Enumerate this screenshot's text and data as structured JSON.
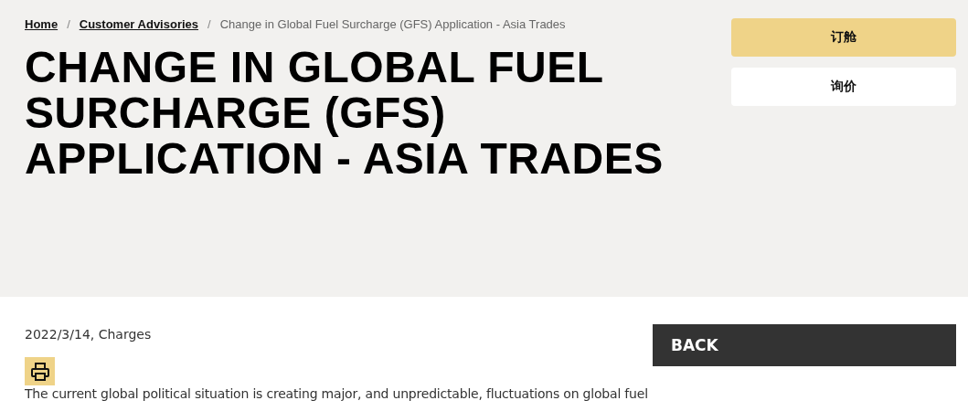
{
  "breadcrumbs": [
    {
      "label": "Home",
      "current": false
    },
    {
      "label": "Customer Advisories",
      "current": false
    },
    {
      "label": "Change in Global Fuel Surcharge (GFS) Application - Asia Trades",
      "current": true
    }
  ],
  "separator": "/",
  "title": "CHANGE IN GLOBAL FUEL SURCHARGE (GFS) APPLICATION - ASIA TRADES",
  "actions": [
    {
      "label": "订舱",
      "kind": "primary"
    },
    {
      "label": "询价",
      "kind": "secondary"
    }
  ],
  "meta": "2022/3/14, Charges",
  "back_button": "BACK",
  "body": "The current global political situation is creating major, and unpredictable, fluctuations on global fuel"
}
